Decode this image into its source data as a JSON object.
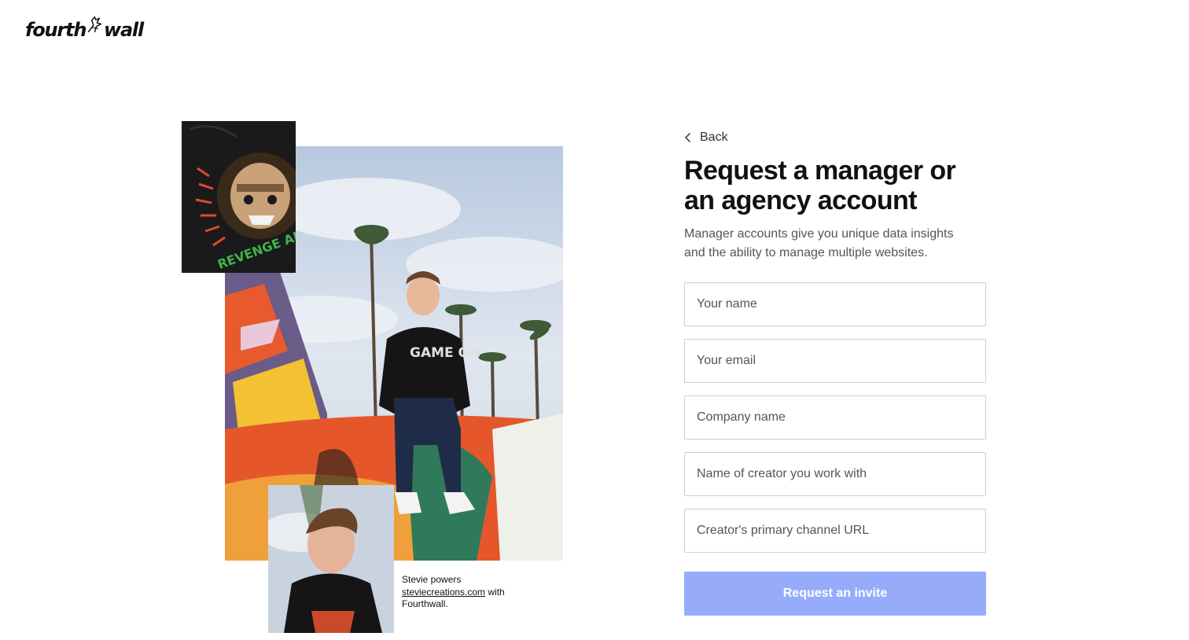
{
  "brand": {
    "logo_left": "fourth",
    "logo_right": "wall"
  },
  "collage": {
    "caption_prefix": "Stevie powers",
    "caption_link": "steviecreations.com",
    "caption_suffix": "with Fourthwall.",
    "hoodie_print_text": "REVENGE ART",
    "shirt_print_text": "GAME ON"
  },
  "form": {
    "back_label": "Back",
    "title": "Request a manager or an agency account",
    "subtitle": "Manager accounts give you unique data insights and the ability to manage multiple websites.",
    "fields": {
      "name_placeholder": "Your name",
      "email_placeholder": "Your email",
      "company_placeholder": "Company name",
      "creator_placeholder": "Name of creator you work with",
      "channel_placeholder": "Creator's primary channel URL"
    },
    "submit_label": "Request an invite"
  },
  "colors": {
    "accent_button": "#96acfb",
    "text_primary": "#111111",
    "text_secondary": "#555555",
    "field_border": "#cfcfcf"
  },
  "icons": {
    "back": "chevron-left-icon",
    "logo_mark": "bird-logo-icon"
  }
}
